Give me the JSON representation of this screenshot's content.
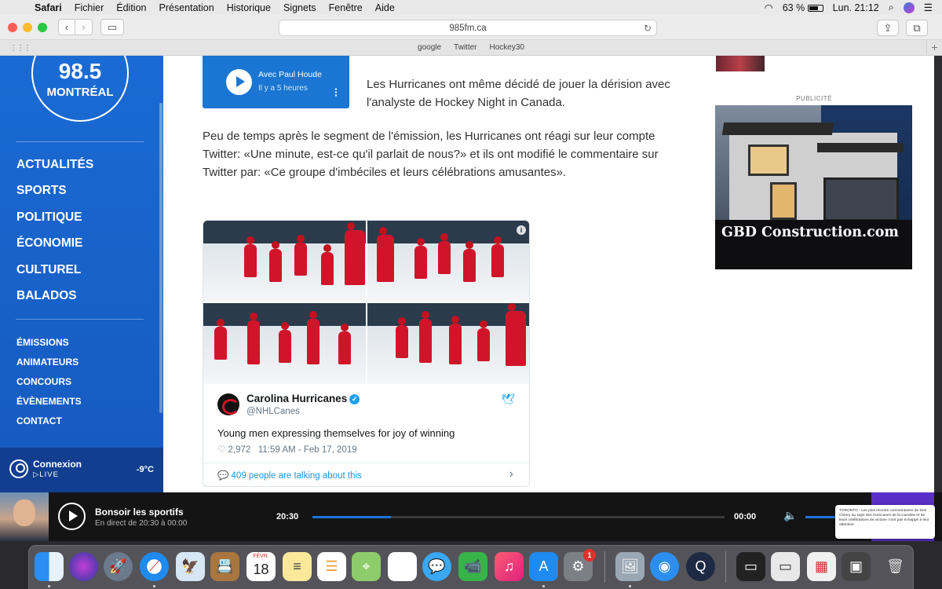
{
  "menubar": {
    "app": "Safari",
    "items": [
      "Fichier",
      "Édition",
      "Présentation",
      "Historique",
      "Signets",
      "Fenêtre",
      "Aide"
    ],
    "battery": "63 %",
    "clock": "Lun. 21:12"
  },
  "browser": {
    "url": "985fm.ca",
    "bookmarks": [
      "google",
      "Twitter",
      "Hockey30"
    ]
  },
  "sidebar": {
    "logo_number": "98.5",
    "logo_city": "MONTRÉAL",
    "main_nav": [
      "ACTUALITÉS",
      "SPORTS",
      "POLITIQUE",
      "ÉCONOMIE",
      "CULTUREL",
      "BALADOS"
    ],
    "secondary_nav": [
      "ÉMISSIONS",
      "ANIMATEURS",
      "CONCOURS",
      "ÉVÈNEMENTS",
      "CONTACT"
    ],
    "login_label": "Connexion",
    "live_label": "▷LIVE",
    "temperature": "-9°C"
  },
  "audio_card": {
    "title": "Avec Paul Houde",
    "time": "Il y a 5 heures"
  },
  "article": {
    "paragraph1": "Les Hurricanes ont même décidé de jouer la dérision avec l'analyste de Hockey Night in Canada.",
    "paragraph2": "Peu de temps après le segment de l'émission, les Hurricanes ont réagi sur leur compte Twitter: «Une minute, est-ce qu'il parlait de nous?» et ils ont modifié le commentaire sur Twitter par: «Ce groupe d'imbéciles et leurs célébrations amusantes»."
  },
  "tweet": {
    "author": "Carolina Hurricanes",
    "handle": "@NHLCanes",
    "text": "Young men expressing themselves for joy of winning",
    "likes": "2,972",
    "timestamp": "11:59 AM - Feb 17, 2019",
    "talking": "409 people are talking about this"
  },
  "ad": {
    "label": "PUBLICITÉ",
    "brand": "GBD Construction.com"
  },
  "player": {
    "show": "Bonsoir les sportifs",
    "subtitle": "En direct de 20:30 à 00:00",
    "time_start": "20:30",
    "time_end": "00:00",
    "progress": 0.19
  },
  "notification": {
    "text": "TORONTO - Les plus récents commentaires de Don Cherry au sujet des Hurricanes de la Caroline et de leurs célébrations de victoire n'ont pas échappé à leur attention."
  },
  "dock": {
    "calendar_month": "FÉVR.",
    "calendar_day": "18",
    "appstore_badge": "1"
  },
  "colors": {
    "sidebar": "#1a6bd4",
    "accent": "#1f73d9",
    "player_bg": "#141414",
    "twitter": "#1da1f2"
  }
}
